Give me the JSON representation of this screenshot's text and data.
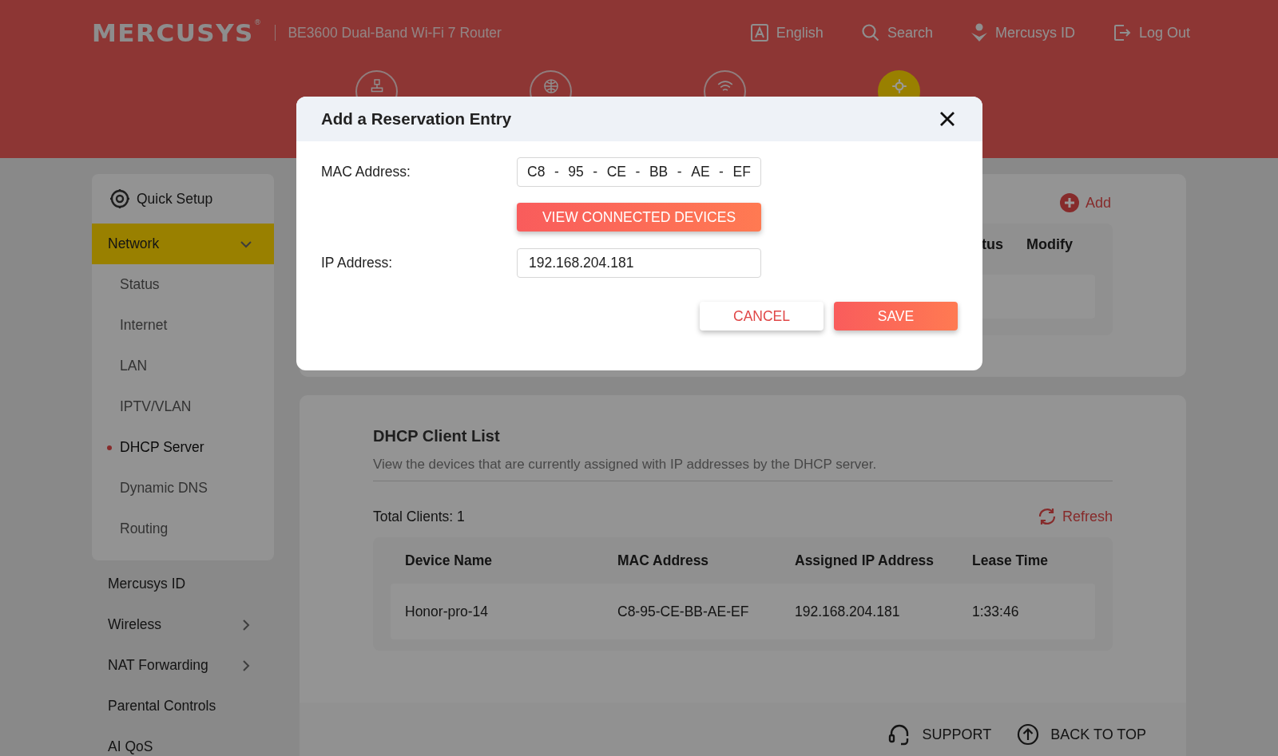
{
  "header": {
    "logo": "MERCUSYS",
    "logo_mark": "®",
    "product": "BE3600 Dual-Band Wi-Fi 7 Router",
    "links": [
      {
        "kind": "language",
        "label": "English"
      },
      {
        "kind": "search",
        "label": "Search"
      },
      {
        "kind": "account",
        "label": "Mercusys ID"
      },
      {
        "kind": "logout",
        "label": "Log Out"
      }
    ]
  },
  "nav_tabs": [
    {
      "kind": "network",
      "selected": false
    },
    {
      "kind": "internet",
      "selected": false
    },
    {
      "kind": "wireless",
      "selected": false
    },
    {
      "kind": "advanced",
      "selected": true
    }
  ],
  "sidebar": {
    "items": [
      {
        "kind": "setup",
        "label": "Quick Setup",
        "selected": false
      },
      {
        "kind": "group",
        "label": "Network",
        "selected": true,
        "expanded": true,
        "children": [
          {
            "label": "Status",
            "selected": false
          },
          {
            "label": "Internet",
            "selected": false
          },
          {
            "label": "LAN",
            "selected": false
          },
          {
            "label": "IPTV/VLAN",
            "selected": false
          },
          {
            "label": "DHCP Server",
            "selected": true
          },
          {
            "label": "Dynamic DNS",
            "selected": false
          },
          {
            "label": "Routing",
            "selected": false
          }
        ]
      },
      {
        "kind": "plain",
        "label": "Mercusys ID",
        "selected": false
      },
      {
        "kind": "group",
        "label": "Wireless",
        "selected": false,
        "expanded": false
      },
      {
        "kind": "group",
        "label": "NAT Forwarding",
        "selected": false,
        "expanded": false
      },
      {
        "kind": "plain",
        "label": "Parental Controls",
        "selected": false
      },
      {
        "kind": "plain",
        "label": "AI QoS",
        "selected": false
      }
    ]
  },
  "reservation": {
    "add_button": "Add",
    "columns": [
      "tus",
      "Modify"
    ]
  },
  "clients": {
    "title": "DHCP Client List",
    "description": "View the devices that are currently assigned with IP addresses by the DHCP server.",
    "total": "Total Clients: 1",
    "refresh": "Refresh",
    "columns": [
      "Device Name",
      "MAC Address",
      "Assigned IP Address",
      "Lease Time"
    ],
    "rows": [
      [
        "Honor-pro-14",
        "C8-95-CE-BB-AE-EF",
        "192.168.204.181",
        "1:33:46"
      ]
    ]
  },
  "footer": {
    "support": "SUPPORT",
    "back_to_top": "BACK TO TOP"
  },
  "modal": {
    "title": "Add a Reservation Entry",
    "mac_label": "MAC Address:",
    "mac_parts": [
      "C8",
      "-",
      "95",
      "-",
      "CE",
      "-",
      "BB",
      "-",
      "AE",
      "-",
      "EF"
    ],
    "view_button": "VIEW CONNECTED DEVICES",
    "ip_label": "IP Address:",
    "ip_value": "192.168.204.181",
    "cancel": "CANCEL",
    "save": "SAVE"
  }
}
